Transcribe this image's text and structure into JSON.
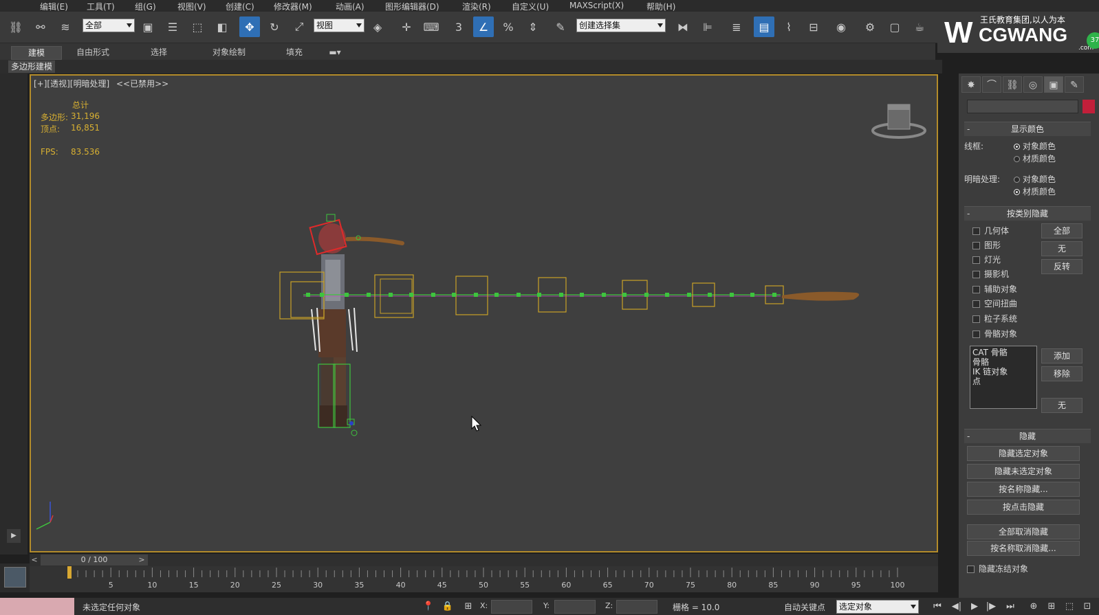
{
  "menu": [
    "编辑(E)",
    "工具(T)",
    "组(G)",
    "视图(V)",
    "创建(C)",
    "修改器(M)",
    "动画(A)",
    "图形编辑器(D)",
    "渲染(R)",
    "自定义(U)",
    "MAXScript(X)",
    "帮助(H)"
  ],
  "toolbar": {
    "selection_filter": "全部",
    "ref_coord": "视图",
    "named_selection": "创建选择集"
  },
  "logo": {
    "mark": "W",
    "brand": "CGWANG",
    "slogan": "王氏教育集团,以人为本",
    "domain_suffix": ".com",
    "badge": "37"
  },
  "ribbon": {
    "tabs": [
      "建模",
      "自由形式",
      "选择",
      "对象绘制",
      "填充"
    ],
    "active_tab": "建模",
    "sub_label": "多边形建模"
  },
  "viewport": {
    "label": "[+][透视][明暗处理]",
    "disabled_label": "<<已禁用>>",
    "stats": {
      "header": "总计",
      "poly_label": "多边形:",
      "poly_value": "31,196",
      "vert_label": "顶点:",
      "vert_value": "16,851",
      "fps_label": "FPS:",
      "fps_value": "83.536"
    }
  },
  "timeline": {
    "frame_display": "0 / 100",
    "prev": "<",
    "next": ">",
    "ticks": [
      5,
      10,
      15,
      20,
      25,
      30,
      35,
      40,
      45,
      50,
      55,
      60,
      65,
      70,
      75,
      80,
      85,
      90,
      95,
      100
    ]
  },
  "status": {
    "message": "未选定任何对象",
    "x_label": "X:",
    "y_label": "Y:",
    "z_label": "Z:",
    "grid": "栅格 = 10.0",
    "auto_key": "自动关键点",
    "key_filter": "选定对象"
  },
  "panel": {
    "display_color": {
      "title": "显示颜色",
      "wireframe_label": "线框:",
      "shaded_label": "明暗处理:",
      "option_object": "对象颜色",
      "option_material": "材质颜色"
    },
    "hide_by_category": {
      "title": "按类别隐藏",
      "items": [
        "几何体",
        "图形",
        "灯光",
        "摄影机",
        "辅助对象",
        "空间扭曲",
        "粒子系统",
        "骨骼对象"
      ],
      "btn_all": "全部",
      "btn_none": "无",
      "btn_invert": "反转",
      "list": [
        "CAT 骨骼",
        "骨骼",
        "IK 链对象",
        "点"
      ],
      "btn_add": "添加",
      "btn_remove": "移除",
      "btn_none2": "无"
    },
    "hide": {
      "title": "隐藏",
      "buttons": [
        "隐藏选定对象",
        "隐藏未选定对象",
        "按名称隐藏...",
        "按点击隐藏",
        "全部取消隐藏",
        "按名称取消隐藏..."
      ],
      "freeze_label": "隐藏冻结对象"
    }
  },
  "colors": {
    "viewport_border": "#b48c2a",
    "stats_text": "#d8b032",
    "active_tool": "#2f6fb5",
    "bone_box": "#c9a227",
    "bone_link": "#3ec43e"
  }
}
